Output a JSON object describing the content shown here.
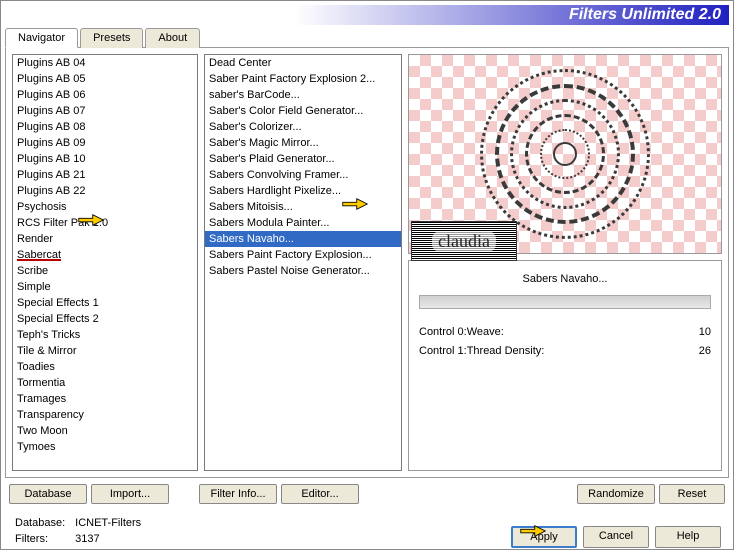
{
  "title": "Filters Unlimited 2.0",
  "tabs": [
    {
      "label": "Navigator",
      "active": true
    },
    {
      "label": "Presets",
      "active": false
    },
    {
      "label": "About",
      "active": false
    }
  ],
  "categories": [
    "Plugins AB 04",
    "Plugins AB 05",
    "Plugins AB 06",
    "Plugins AB 07",
    "Plugins AB 08",
    "Plugins AB 09",
    "Plugins AB 10",
    "Plugins AB 21",
    "Plugins AB 22",
    "Psychosis",
    "RCS Filter Pak 1.0",
    "Render",
    "Sabercat",
    "Scribe",
    "Simple",
    "Special Effects 1",
    "Special Effects 2",
    "Teph's Tricks",
    "Tile & Mirror",
    "Toadies",
    "Tormentia",
    "Tramages",
    "Transparency",
    "Two Moon",
    "Tymoes"
  ],
  "category_highlight_index": 12,
  "filters": [
    "Dead Center",
    "Saber Paint Factory Explosion 2...",
    "saber's BarCode...",
    "Saber's Color Field Generator...",
    "Saber's Colorizer...",
    "Saber's Magic Mirror...",
    "Saber's Plaid Generator...",
    "Sabers Convolving Framer...",
    "Sabers Hardlight Pixelize...",
    "Sabers Mitoisis...",
    "Sabers Modula Painter...",
    "Sabers Navaho...",
    "Sabers Paint Factory Explosion...",
    "Sabers Pastel Noise Generator..."
  ],
  "filter_selected_index": 11,
  "selected_filter_name": "Sabers Navaho...",
  "controls": [
    {
      "label": "Control 0:Weave:",
      "value": "10"
    },
    {
      "label": "Control 1:Thread Density:",
      "value": "26"
    }
  ],
  "btn_row1": {
    "database": "Database",
    "import": "Import...",
    "filter_info": "Filter Info...",
    "editor": "Editor...",
    "randomize": "Randomize",
    "reset": "Reset"
  },
  "footer": {
    "db_label": "Database:",
    "db_value": "ICNET-Filters",
    "filters_label": "Filters:",
    "filters_value": "3137",
    "apply": "Apply",
    "cancel": "Cancel",
    "help": "Help"
  },
  "watermark": "claudia"
}
